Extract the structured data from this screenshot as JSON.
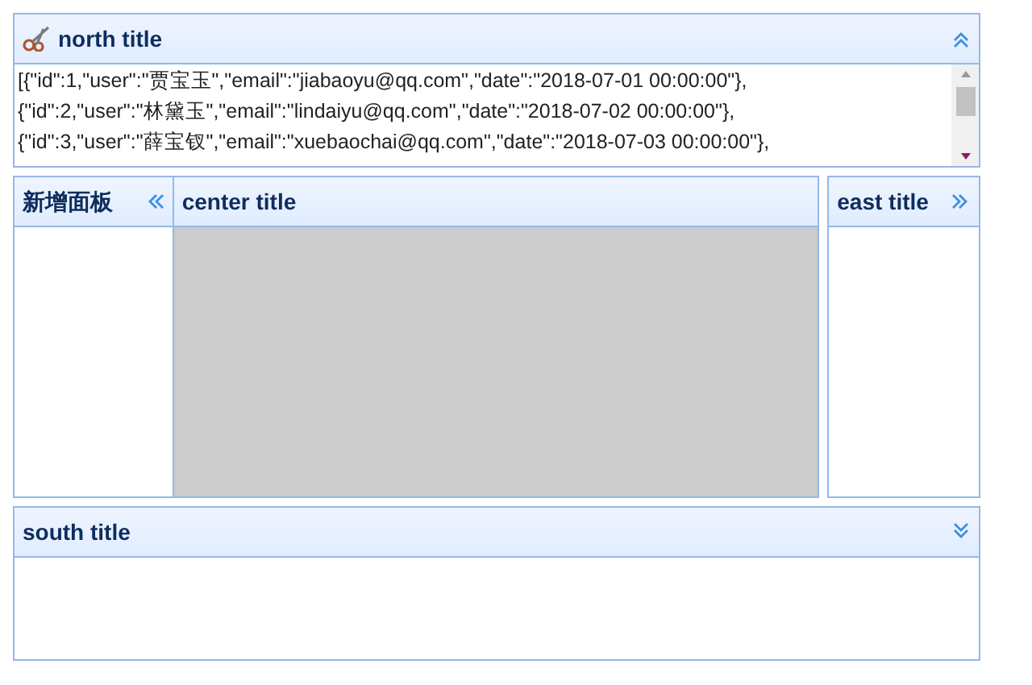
{
  "north": {
    "title": "north title",
    "kind": "up",
    "lines": [
      "[{\"id\":1,\"user\":\"贾宝玉\",\"email\":\"jiabaoyu@qq.com\",\"date\":\"2018-07-01 00:00:00\"},",
      "{\"id\":2,\"user\":\"林黛玉\",\"email\":\"lindaiyu@qq.com\",\"date\":\"2018-07-02 00:00:00\"},",
      "{\"id\":3,\"user\":\"薛宝钗\",\"email\":\"xuebaochai@qq.com\",\"date\":\"2018-07-03 00:00:00\"},"
    ]
  },
  "west": {
    "title": "新增面板",
    "kind": "left"
  },
  "center": {
    "title": "center title"
  },
  "east": {
    "title": "east title",
    "kind": "right"
  },
  "south": {
    "title": "south title",
    "kind": "down"
  }
}
